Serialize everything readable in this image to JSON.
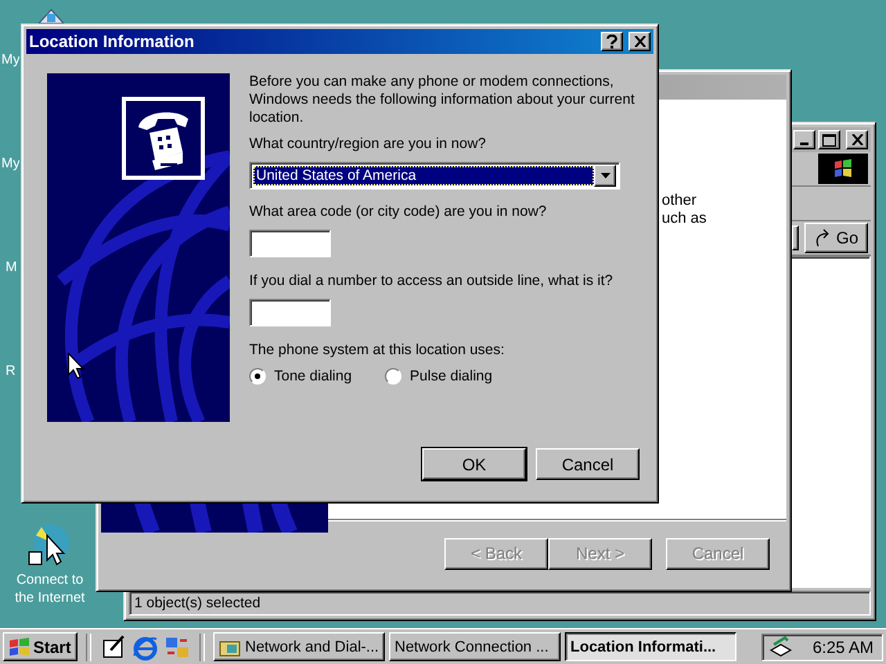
{
  "desktop_icons": [
    {
      "label": "My"
    },
    {
      "label": "My"
    },
    {
      "label": "M"
    },
    {
      "label": "R"
    },
    {
      "label": "Connect to the Internet"
    }
  ],
  "explorer_window": {
    "go_button": "Go",
    "status_bar": "1 object(s) selected"
  },
  "wizard_window": {
    "text_lines": [
      "other",
      "uch as"
    ],
    "buttons": [
      {
        "label": "< Back",
        "disabled": true
      },
      {
        "label": "Next >",
        "disabled": true
      },
      {
        "label": "Cancel",
        "disabled": true
      }
    ]
  },
  "dialog": {
    "title": "Location Information",
    "intro": "Before you can make any phone or modem connections, Windows needs the following information about your current location.",
    "country_label": "What country/region are you in now?",
    "country_value": "United States of America",
    "area_code_label": "What area code (or city code) are you in now?",
    "outside_line_label": "If you dial a number to access an outside line, what is it?",
    "phone_system_label": "The phone system at this location uses:",
    "dialing_options": [
      {
        "label": "Tone dialing",
        "selected": true
      },
      {
        "label": "Pulse dialing",
        "selected": false
      }
    ],
    "buttons": [
      {
        "label": "OK",
        "default": true
      },
      {
        "label": "Cancel",
        "default": false
      }
    ]
  },
  "taskbar": {
    "start": "Start",
    "tasks": [
      {
        "label": "Network and Dial-...",
        "selected": false
      },
      {
        "label": "Network Connection ...",
        "selected": false
      },
      {
        "label": "Location Informati...",
        "selected": true
      }
    ],
    "clock": "6:25 AM"
  }
}
